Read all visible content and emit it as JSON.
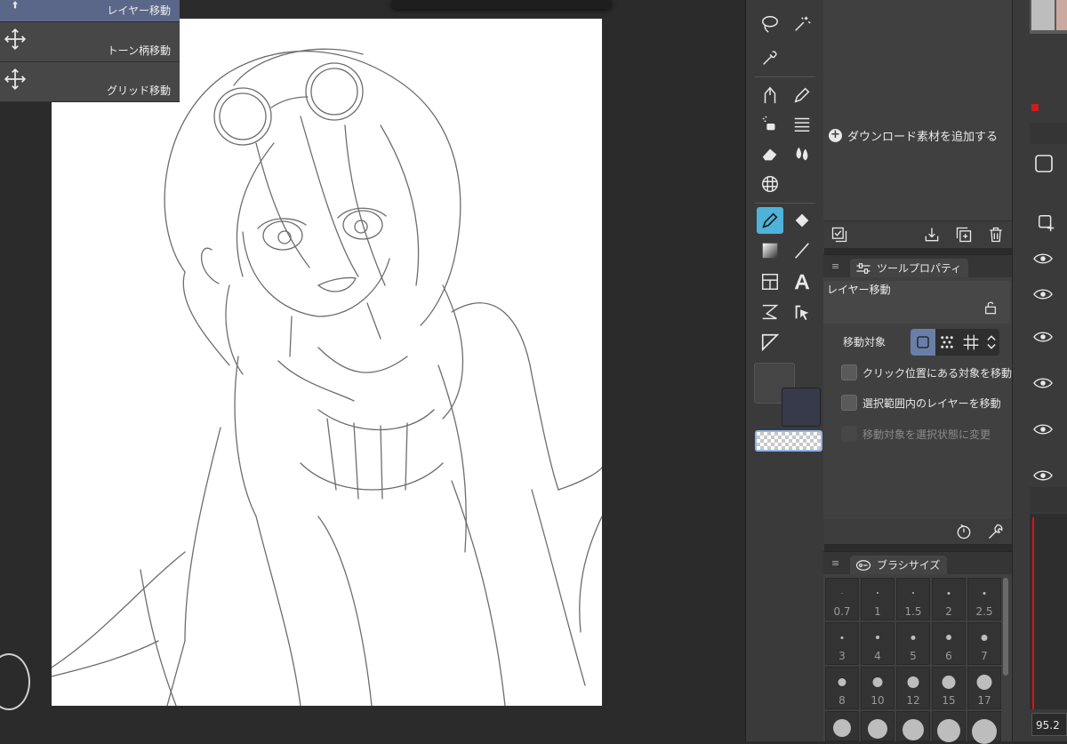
{
  "app": {
    "accent": "#4fb3d9",
    "selection_color": "#5a6788"
  },
  "sub_tool": {
    "items": [
      {
        "label": "レイヤー移動",
        "icon": "move-arrow-icon",
        "selected": true
      },
      {
        "label": "トーン柄移動",
        "icon": "move-cross-icon",
        "selected": false
      },
      {
        "label": "グリッド移動",
        "icon": "move-cross-icon",
        "selected": false
      }
    ],
    "add_download": "ダウンロード素材を追加する"
  },
  "tool_property": {
    "tab_label": "ツールプロパティ",
    "tool_name": "レイヤー移動",
    "move_target_label": "移動対象",
    "options": [
      {
        "label": "クリック位置にある対象を移動",
        "checked": false,
        "disabled": false
      },
      {
        "label": "選択範囲内のレイヤーを移動",
        "checked": false,
        "disabled": false
      },
      {
        "label": "移動対象を選択状態に変更",
        "checked": false,
        "disabled": true
      }
    ]
  },
  "brush_size": {
    "tab_label": "ブラシサイズ",
    "sizes": [
      "0.7",
      "1",
      "1.5",
      "2",
      "2.5",
      "3",
      "4",
      "5",
      "6",
      "7",
      "8",
      "10",
      "12",
      "15",
      "17"
    ]
  },
  "colors": {
    "main": "#454545",
    "sub": "#363a4a"
  },
  "zoom": {
    "value": "95.2"
  }
}
